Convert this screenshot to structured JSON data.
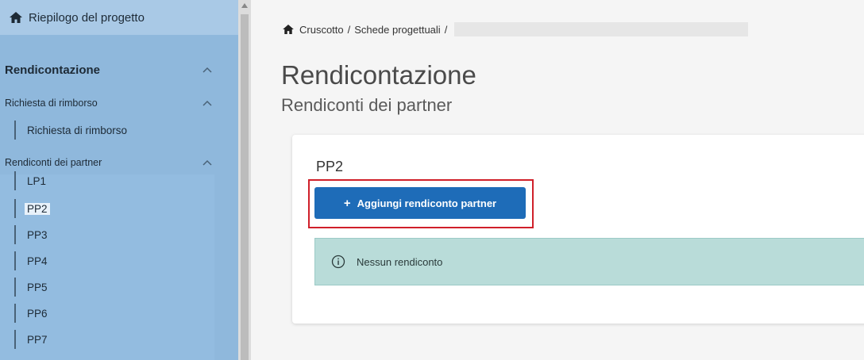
{
  "sidebar": {
    "home_label": "Riepilogo del progetto",
    "section": "Rendicontazione",
    "groups": [
      {
        "label": "Richiesta di rimborso",
        "items": [
          "Richiesta di rimborso"
        ]
      },
      {
        "label": "Rendiconti dei partner",
        "items": [
          "LP1",
          "PP2",
          "PP3",
          "PP4",
          "PP5",
          "PP6",
          "PP7"
        ]
      }
    ],
    "active_item": "PP2"
  },
  "breadcrumb": {
    "items": [
      "Cruscotto",
      "Schede progettuali"
    ],
    "separator": "/"
  },
  "page": {
    "title": "Rendicontazione",
    "subtitle": "Rendiconti dei partner"
  },
  "card": {
    "title": "PP2",
    "add_button_label": "Aggiungi rendiconto partner",
    "add_button_icon": "+",
    "empty_message": "Nessun rendiconto"
  },
  "colors": {
    "sidebar_bg": "#8fb8dc",
    "primary_button": "#1e6cb8",
    "info_alert_bg": "#b9dcd9",
    "highlight_border": "#d0202a"
  },
  "icons": {
    "home": "home-icon",
    "chevron": "chevron-up-icon",
    "info": "info-circle-icon"
  }
}
